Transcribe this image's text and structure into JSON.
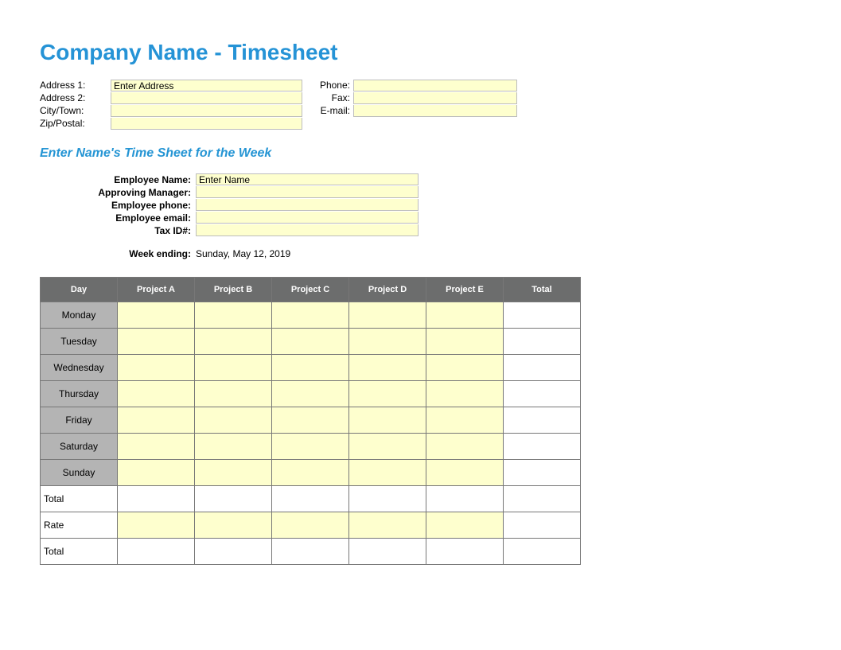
{
  "title": "Company Name -  Timesheet",
  "company": {
    "labels": {
      "address1": "Address 1:",
      "address2": "Address 2:",
      "cityTown": "City/Town:",
      "zipPostal": "Zip/Postal:",
      "phone": "Phone:",
      "fax": "Fax:",
      "email": "E-mail:"
    },
    "values": {
      "address1": "Enter Address",
      "address2": "",
      "cityTown": "",
      "zipPostal": "",
      "phone": "",
      "fax": "",
      "email": ""
    }
  },
  "subheader": "Enter Name's Time Sheet for the Week",
  "employee": {
    "labels": {
      "name": "Employee Name:",
      "manager": "Approving Manager:",
      "phone": "Employee phone:",
      "email": "Employee email:",
      "taxId": "Tax ID#:"
    },
    "values": {
      "name": "Enter Name",
      "manager": "",
      "phone": "",
      "email": "",
      "taxId": ""
    }
  },
  "weekEnding": {
    "label": "Week ending:",
    "value": "Sunday, May 12, 2019"
  },
  "table": {
    "headers": {
      "day": "Day",
      "projA": "Project A",
      "projB": "Project B",
      "projC": "Project C",
      "projD": "Project D",
      "projE": "Project E",
      "total": "Total"
    },
    "days": {
      "mon": "Monday",
      "tue": "Tuesday",
      "wed": "Wednesday",
      "thu": "Thursday",
      "fri": "Friday",
      "sat": "Saturday",
      "sun": "Sunday"
    },
    "summaryLabels": {
      "total": "Total",
      "rate": "Rate",
      "grandTotal": "Total"
    }
  }
}
